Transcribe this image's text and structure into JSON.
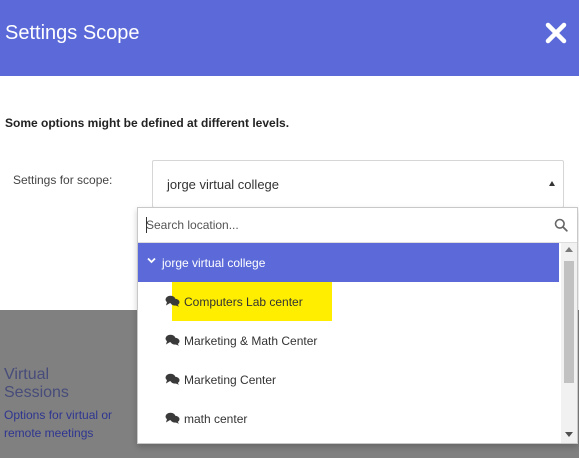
{
  "modal": {
    "title": "Settings Scope",
    "info_text": "Some options might be defined at different levels.",
    "scope_label": "Settings for scope:",
    "selected_scope": "jorge virtual college"
  },
  "dropdown": {
    "search_placeholder": "Search location...",
    "parent": "jorge virtual college",
    "children": [
      {
        "label": "Computers Lab center",
        "highlighted": true
      },
      {
        "label": "Marketing & Math Center",
        "highlighted": false
      },
      {
        "label": "Marketing Center",
        "highlighted": false
      },
      {
        "label": "math center",
        "highlighted": false
      }
    ]
  },
  "background": {
    "section_title": "Virtual Sessions",
    "section_desc": "Options for virtual or remote meetings"
  },
  "icons": {
    "close": "close-icon",
    "caret": "caret-up-icon",
    "search": "search-icon",
    "chevron": "chevron-down-icon",
    "item": "comments-icon"
  },
  "colors": {
    "header": "#5b6ad8",
    "highlight": "#ffee00"
  }
}
